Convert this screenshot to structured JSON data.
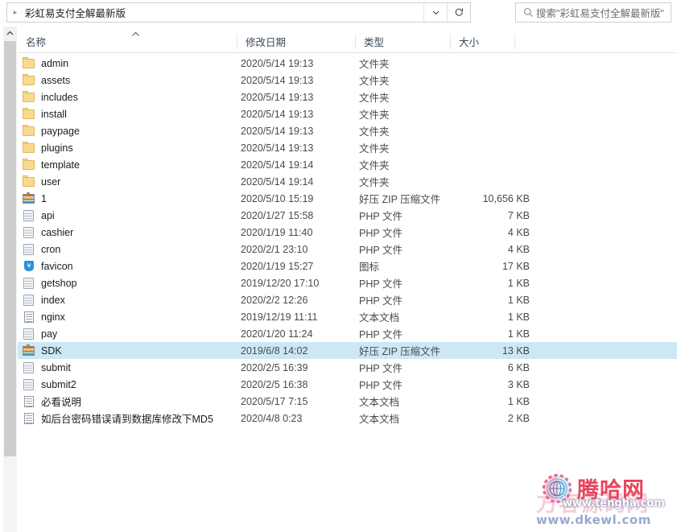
{
  "window": {
    "address_crumb": "彩虹易支付全解最新版",
    "history_dropdown_icon": "chevron-down-icon",
    "refresh_icon": "refresh-icon",
    "search_icon": "search-icon",
    "search_placeholder": "搜索\"彩虹易支付全解最新版\""
  },
  "columns": [
    {
      "label": "名称",
      "key": "name"
    },
    {
      "label": "修改日期",
      "key": "date"
    },
    {
      "label": "类型",
      "key": "type"
    },
    {
      "label": "大小",
      "key": "size"
    }
  ],
  "sort": {
    "column": "名称",
    "direction": "ascending",
    "indicator": "caret-up-icon"
  },
  "types": {
    "folder": "文件夹",
    "zip": "好压 ZIP 压缩文件",
    "php": "PHP 文件",
    "icon": "图标",
    "text": "文本文档"
  },
  "rows": [
    {
      "name": "admin",
      "date": "2020/5/14 19:13",
      "type": "文件夹",
      "size": "",
      "icon": "folder-icon",
      "selected": false
    },
    {
      "name": "assets",
      "date": "2020/5/14 19:13",
      "type": "文件夹",
      "size": "",
      "icon": "folder-icon",
      "selected": false
    },
    {
      "name": "includes",
      "date": "2020/5/14 19:13",
      "type": "文件夹",
      "size": "",
      "icon": "folder-icon",
      "selected": false
    },
    {
      "name": "install",
      "date": "2020/5/14 19:13",
      "type": "文件夹",
      "size": "",
      "icon": "folder-icon",
      "selected": false
    },
    {
      "name": "paypage",
      "date": "2020/5/14 19:13",
      "type": "文件夹",
      "size": "",
      "icon": "folder-icon",
      "selected": false
    },
    {
      "name": "plugins",
      "date": "2020/5/14 19:13",
      "type": "文件夹",
      "size": "",
      "icon": "folder-icon",
      "selected": false
    },
    {
      "name": "template",
      "date": "2020/5/14 19:14",
      "type": "文件夹",
      "size": "",
      "icon": "folder-icon",
      "selected": false
    },
    {
      "name": "user",
      "date": "2020/5/14 19:14",
      "type": "文件夹",
      "size": "",
      "icon": "folder-icon",
      "selected": false
    },
    {
      "name": "1",
      "date": "2020/5/10 15:19",
      "type": "好压 ZIP 压缩文件",
      "size": "10,656 KB",
      "icon": "zip-icon",
      "selected": false
    },
    {
      "name": "api",
      "date": "2020/1/27 15:58",
      "type": "PHP 文件",
      "size": "7 KB",
      "icon": "php-icon",
      "selected": false
    },
    {
      "name": "cashier",
      "date": "2020/1/19 11:40",
      "type": "PHP 文件",
      "size": "4 KB",
      "icon": "php-icon",
      "selected": false
    },
    {
      "name": "cron",
      "date": "2020/2/1 23:10",
      "type": "PHP 文件",
      "size": "4 KB",
      "icon": "php-icon",
      "selected": false
    },
    {
      "name": "favicon",
      "date": "2020/1/19 15:27",
      "type": "图标",
      "size": "17 KB",
      "icon": "favicon-icon",
      "selected": false
    },
    {
      "name": "getshop",
      "date": "2019/12/20 17:10",
      "type": "PHP 文件",
      "size": "1 KB",
      "icon": "php-icon",
      "selected": false
    },
    {
      "name": "index",
      "date": "2020/2/2 12:26",
      "type": "PHP 文件",
      "size": "1 KB",
      "icon": "php-icon",
      "selected": false
    },
    {
      "name": "nginx",
      "date": "2019/12/19 11:11",
      "type": "文本文档",
      "size": "1 KB",
      "icon": "text-icon",
      "selected": false
    },
    {
      "name": "pay",
      "date": "2020/1/20 11:24",
      "type": "PHP 文件",
      "size": "1 KB",
      "icon": "php-icon",
      "selected": false
    },
    {
      "name": "SDK",
      "date": "2019/6/8 14:02",
      "type": "好压 ZIP 压缩文件",
      "size": "13 KB",
      "icon": "zip-icon",
      "selected": true
    },
    {
      "name": "submit",
      "date": "2020/2/5 16:39",
      "type": "PHP 文件",
      "size": "6 KB",
      "icon": "php-icon",
      "selected": false
    },
    {
      "name": "submit2",
      "date": "2020/2/5 16:38",
      "type": "PHP 文件",
      "size": "3 KB",
      "icon": "php-icon",
      "selected": false
    },
    {
      "name": "必看说明",
      "date": "2020/5/17 7:15",
      "type": "文本文档",
      "size": "1 KB",
      "icon": "text-icon",
      "selected": false
    },
    {
      "name": "如后台密码错误请到数据库修改下MD5",
      "date": "2020/4/8 0:23",
      "type": "文本文档",
      "size": "2 KB",
      "icon": "text-icon",
      "selected": false
    }
  ],
  "watermarks": {
    "front": {
      "logo": "gear-globe-logo",
      "title": "腾哈网",
      "url": "www.tengha.com",
      "title_color": "#e8455c"
    },
    "back": {
      "title": "方客源码网",
      "url": "www.dkewl.com",
      "title_color": "#f0c0cf",
      "url_color": "#8899c9"
    }
  },
  "scrollbar": {
    "up_arrow_icon": "caret-up-icon",
    "orientation": "vertical"
  },
  "colors": {
    "selection": "#cce8f4",
    "header_text": "#3a4a5a",
    "border": "#e5e5e5"
  }
}
